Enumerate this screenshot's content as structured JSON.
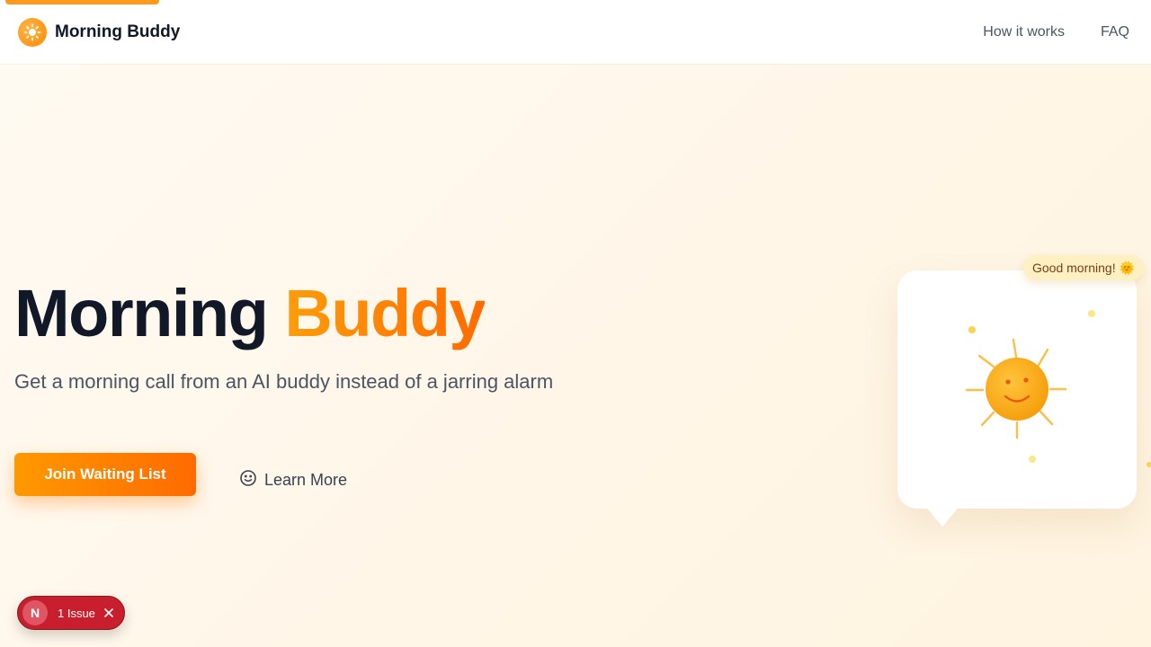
{
  "nav": {
    "brand": "Morning Buddy",
    "links": [
      "How it works",
      "FAQ"
    ]
  },
  "hero": {
    "title_part1": "Morning",
    "title_part2": "Buddy",
    "subtitle": "Get a morning call from an AI buddy instead of a jarring alarm",
    "primary_cta": "Join Waiting List",
    "secondary_cta": "Learn More"
  },
  "illustration": {
    "bubble_text": "Good morning!",
    "bubble_emoji": "🌞"
  },
  "dev_overlay": {
    "badge_letter": "N",
    "issue_label": "1 Issue"
  },
  "colors": {
    "accent": "#ff8a00",
    "accent_gradient": [
      "#ff9d0a",
      "#ff6a00"
    ],
    "issue_red": "#c81e2e"
  },
  "icons": [
    "sun-logo-icon",
    "smile-icon",
    "sun-face-icon",
    "close-icon"
  ]
}
